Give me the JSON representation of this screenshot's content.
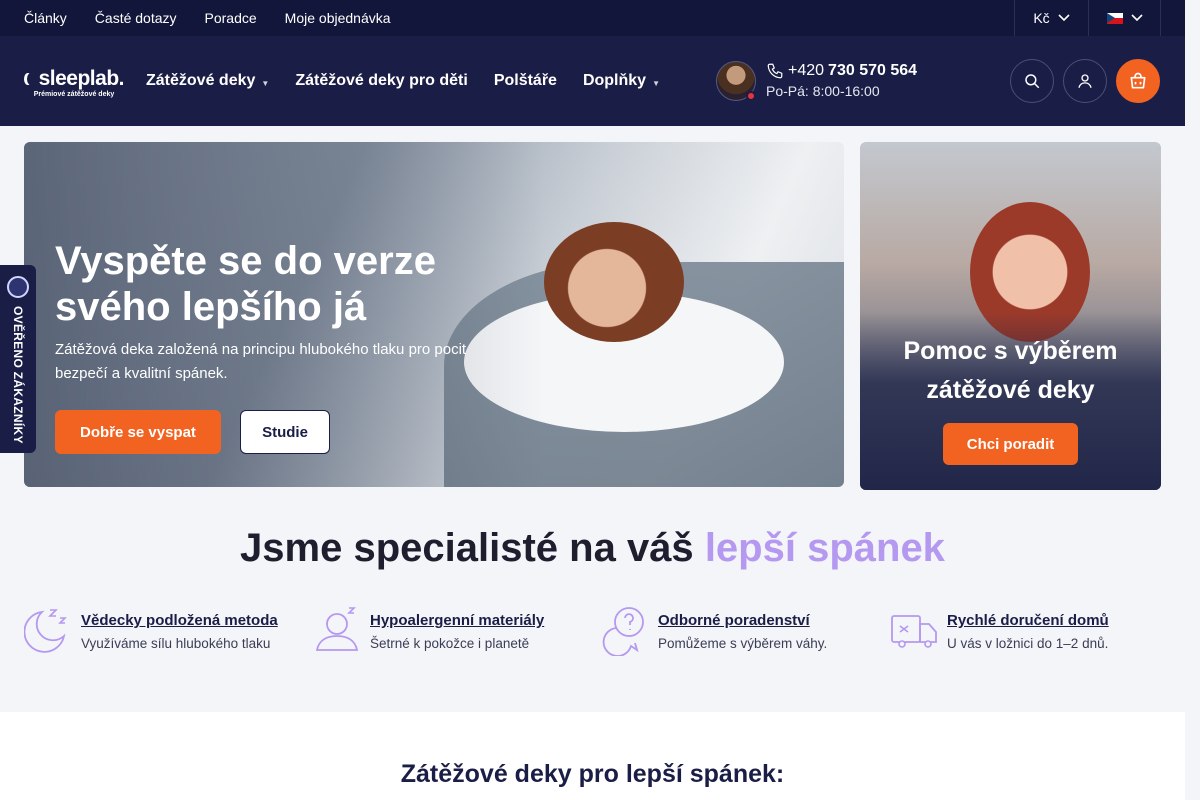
{
  "topbar": {
    "links": [
      "Články",
      "Časté dotazy",
      "Poradce",
      "Moje objednávka"
    ],
    "currency": "Kč"
  },
  "header": {
    "logo_name": "sleeplab.",
    "logo_tagline": "Prémiové zátěžové deky",
    "nav": [
      "Zátěžové deky",
      "Zátěžové deky pro děti",
      "Polštáře",
      "Doplňky"
    ],
    "phone_prefix": "+420",
    "phone_number": "730 570 564",
    "hours": "Po-Pá: 8:00-16:00"
  },
  "badge": {
    "text": "OVĚŘENO ZÁKAZNÍKY"
  },
  "hero": {
    "title": "Vyspěte se do verze svého lepšího já",
    "text": "Zátěžová deka založená na principu hlubokého tlaku pro pocit bezpečí a kvalitní spánek.",
    "primary_button": "Dobře se vyspat",
    "secondary_button": "Studie"
  },
  "side_card": {
    "title": "Pomoc s výběrem zátěžové deky",
    "button": "Chci poradit"
  },
  "specialists": {
    "title_main": "Jsme specialisté na váš",
    "title_accent": "lepší spánek",
    "features": [
      {
        "title": "Vědecky podložená metoda",
        "subtitle": "Využíváme sílu hlubokého tlaku",
        "icon": "moon-sleep-icon"
      },
      {
        "title": "Hypoalergenní materiály",
        "subtitle": "Šetrné k pokožce i planetě",
        "icon": "sleeper-icon"
      },
      {
        "title": "Odborné poradenství",
        "subtitle": "Pomůžeme s výběrem váhy.",
        "icon": "chat-question-icon"
      },
      {
        "title": "Rychlé doručení domů",
        "subtitle": "U vás v ložnici do 1–2 dnů.",
        "icon": "delivery-truck-icon"
      }
    ]
  },
  "bottom": {
    "title": "Zátěžové deky pro lepší spánek:"
  },
  "colors": {
    "navy": "#1a1d45",
    "topbar": "#12163a",
    "orange": "#f26322",
    "accent_purple": "#b598ef",
    "background": "#f4f5f9"
  }
}
